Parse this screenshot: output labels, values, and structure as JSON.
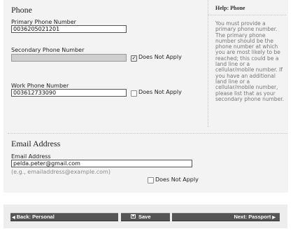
{
  "phone_section": {
    "title": "Phone",
    "primary": {
      "label": "Primary Phone Number",
      "value": "0036205021201"
    },
    "secondary": {
      "label": "Secondary Phone Number",
      "value": "",
      "does_not_apply_label": "Does Not Apply",
      "does_not_apply_checked": true
    },
    "work": {
      "label": "Work Phone Number",
      "value": "003612733090",
      "does_not_apply_label": "Does Not Apply",
      "does_not_apply_checked": false
    }
  },
  "help": {
    "title": "Help: Phone",
    "body": "You must provide a primary phone number. The primary phone number should be the phone number at which you are most likely to be reached; this could be a land line or a cellular/mobile number. If you have an additional land line or a cellular/mobile number, please list that as your secondary phone number."
  },
  "email_section": {
    "title": "Email Address",
    "email": {
      "label": "Email Address",
      "value": "pelda.peter@gmail.com",
      "hint": "(e.g., emailaddress@example.com)",
      "does_not_apply_label": "Does Not Apply",
      "does_not_apply_checked": false
    }
  },
  "nav": {
    "back_label": "Back: Personal",
    "save_label": "Save",
    "next_label": "Next: Passport"
  },
  "colors": {
    "button_bg": "#555555",
    "panel_bg": "#f3f3f3"
  }
}
